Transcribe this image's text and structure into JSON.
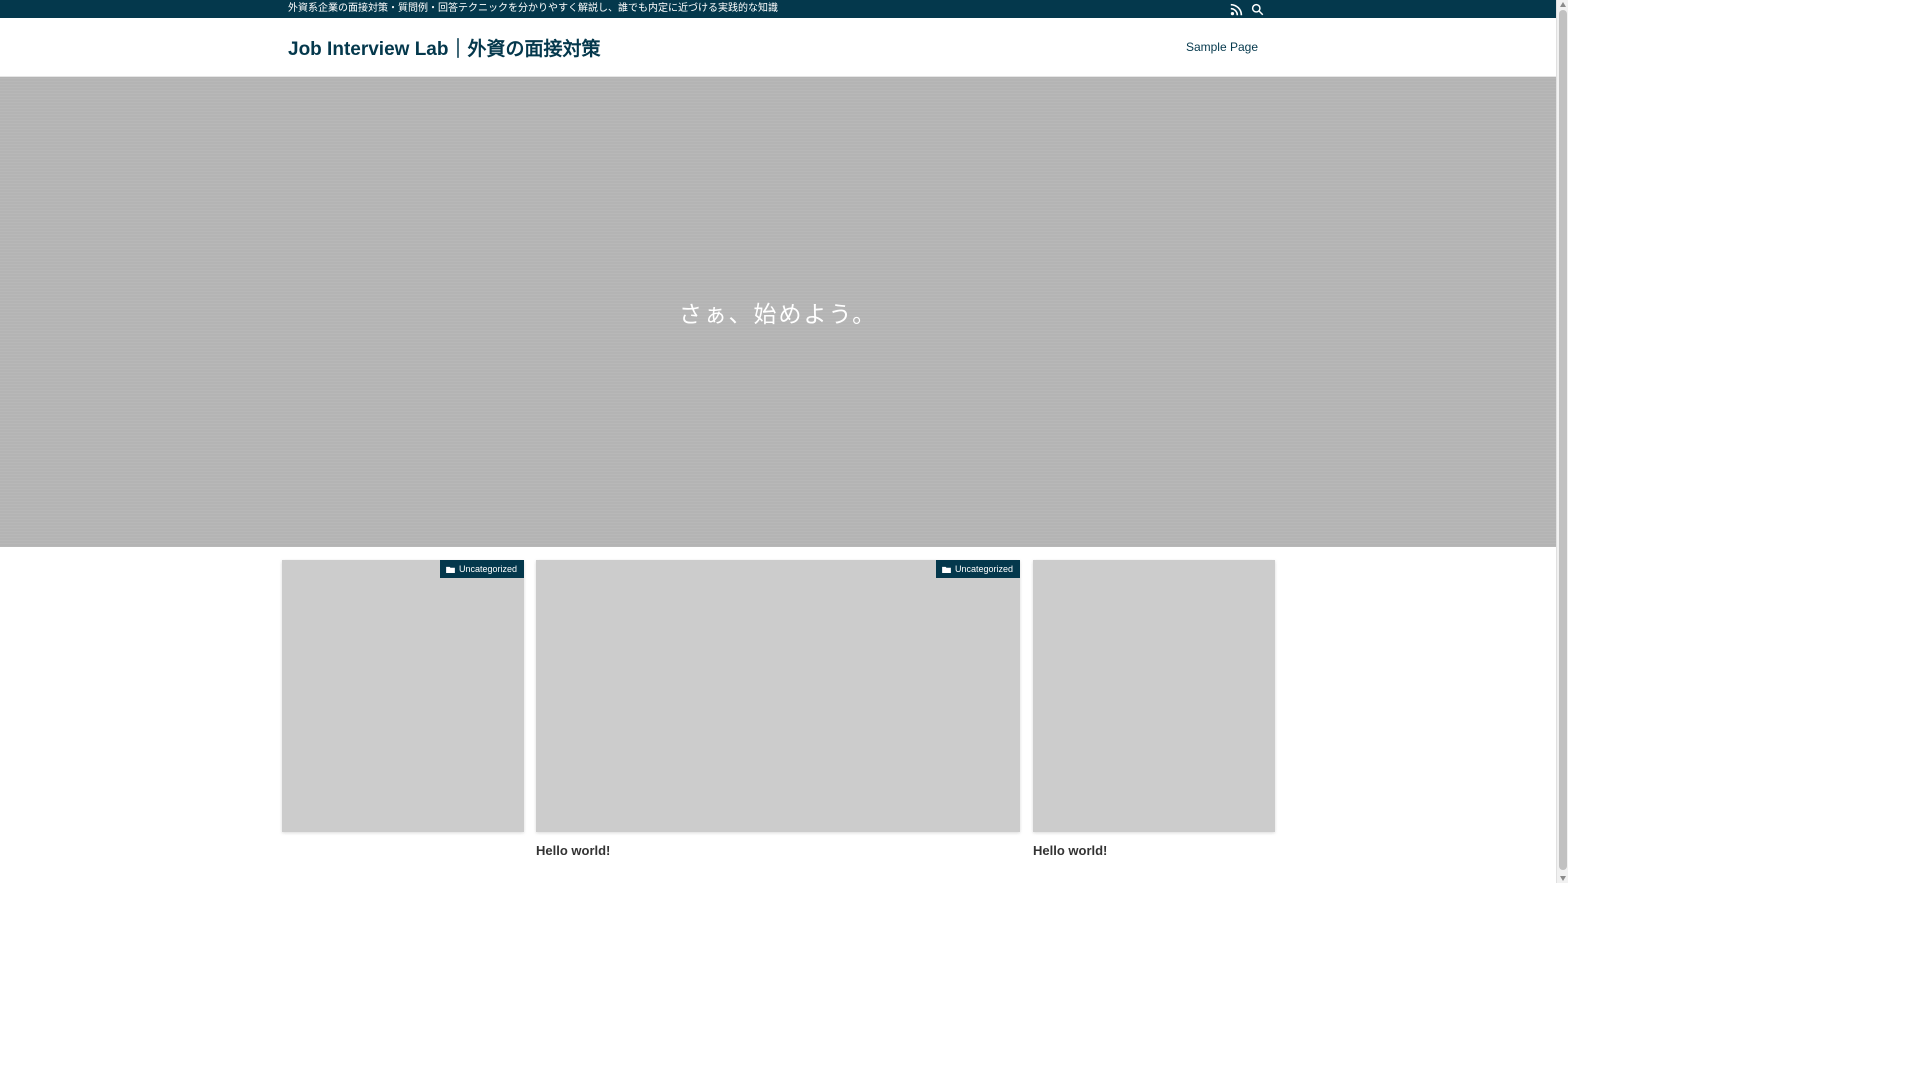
{
  "topbar": {
    "tagline": "外資系企業の面接対策・質問例・回答テクニックを分かりやすく解説し、誰でも内定に近づける実践的な知識",
    "icons": [
      "rss-icon",
      "search-icon"
    ]
  },
  "header": {
    "site_title": "Job Interview Lab｜外資の面接対策",
    "nav": [
      {
        "label": "Sample Page"
      }
    ]
  },
  "hero": {
    "text": "さぁ、始めよう。"
  },
  "cards": [
    {
      "category": "Uncategorized",
      "title": ""
    },
    {
      "category": "Uncategorized",
      "title": "Hello world!"
    },
    {
      "category": "",
      "title": "Hello world!"
    }
  ],
  "colors": {
    "brand": "#04384c",
    "hero_bg": "#b4b4b4",
    "thumb_bg": "#cccccc"
  }
}
